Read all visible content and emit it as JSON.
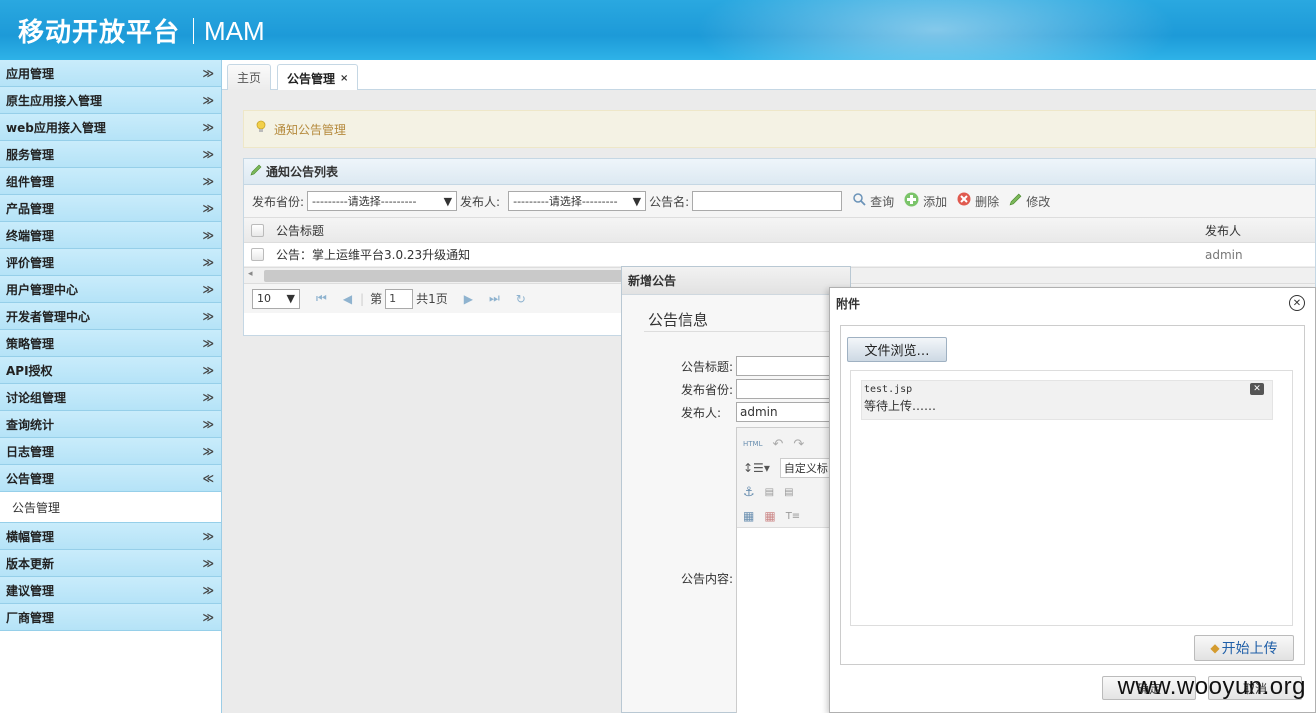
{
  "header": {
    "title": "移动开放平台",
    "subtitle": "MAM"
  },
  "sidebar": {
    "items": [
      {
        "label": "应用管理",
        "icon": "chevron-double-down-icon"
      },
      {
        "label": "原生应用接入管理",
        "icon": "chevron-double-down-icon"
      },
      {
        "label": "web应用接入管理",
        "icon": "chevron-double-down-icon"
      },
      {
        "label": "服务管理",
        "icon": "chevron-double-down-icon"
      },
      {
        "label": "组件管理",
        "icon": "chevron-double-down-icon"
      },
      {
        "label": "产品管理",
        "icon": "chevron-double-down-icon"
      },
      {
        "label": "终端管理",
        "icon": "chevron-double-down-icon"
      },
      {
        "label": "评价管理",
        "icon": "chevron-double-down-icon"
      },
      {
        "label": "用户管理中心",
        "icon": "chevron-double-down-icon"
      },
      {
        "label": "开发者管理中心",
        "icon": "chevron-double-down-icon"
      },
      {
        "label": "策略管理",
        "icon": "chevron-double-down-icon"
      },
      {
        "label": "API授权",
        "icon": "chevron-double-down-icon"
      },
      {
        "label": "讨论组管理",
        "icon": "chevron-double-down-icon"
      },
      {
        "label": "查询统计",
        "icon": "chevron-double-down-icon"
      },
      {
        "label": "日志管理",
        "icon": "chevron-double-down-icon"
      },
      {
        "label": "公告管理",
        "icon": "chevron-double-up-icon",
        "expanded": true
      },
      {
        "label": "横幅管理",
        "icon": "chevron-double-down-icon"
      },
      {
        "label": "版本更新",
        "icon": "chevron-double-down-icon"
      },
      {
        "label": "建议管理",
        "icon": "chevron-double-down-icon"
      },
      {
        "label": "厂商管理",
        "icon": "chevron-double-down-icon"
      }
    ],
    "sub_item": "公告管理",
    "chev_down": "≫",
    "chev_up": "≪"
  },
  "tabs": [
    {
      "label": "主页"
    },
    {
      "label": "公告管理",
      "close": "×"
    }
  ],
  "notice": {
    "text": "通知公告管理",
    "icon": "lightbulb-icon"
  },
  "panel": {
    "title": "通知公告列表",
    "filters": {
      "province_label": "发布省份:",
      "province_value": "---------请选择---------",
      "publisher_label": "发布人:",
      "publisher_value": "---------请选择---------",
      "name_label": "公告名:",
      "name_value": ""
    },
    "actions": {
      "query": "查询",
      "add": "添加",
      "delete": "删除",
      "edit": "修改"
    },
    "columns": {
      "title": "公告标题",
      "publisher": "发布人"
    },
    "rows": [
      {
        "title": "公告：掌上运维平台3.0.23升级通知",
        "publisher": "admin"
      }
    ],
    "pager": {
      "page_size": "10",
      "page_prefix": "第",
      "page": "1",
      "total": "共1页"
    }
  },
  "dialog_new": {
    "title": "新增公告",
    "section": "公告信息",
    "fields": {
      "title_label": "公告标题:",
      "province_label": "发布省份:",
      "publisher_label": "发布人:",
      "publisher_value": "admin",
      "content_label": "公告内容:"
    },
    "editor": {
      "html_btn": "HTML",
      "format_select": "自定义标"
    },
    "ok": "确定",
    "cancel": "取消"
  },
  "dialog_attach": {
    "title": "附件",
    "browse": "文件浏览…",
    "file": {
      "name": "test.jsp",
      "status": "等待上传……"
    },
    "start": "开始上传"
  },
  "watermark": "www.wooyun.org",
  "colors": {
    "header": "#1d9ad8",
    "sidebar_item": "#b5e3f7",
    "notice_text": "#b58a3d",
    "start_text": "#1f5fa8"
  }
}
